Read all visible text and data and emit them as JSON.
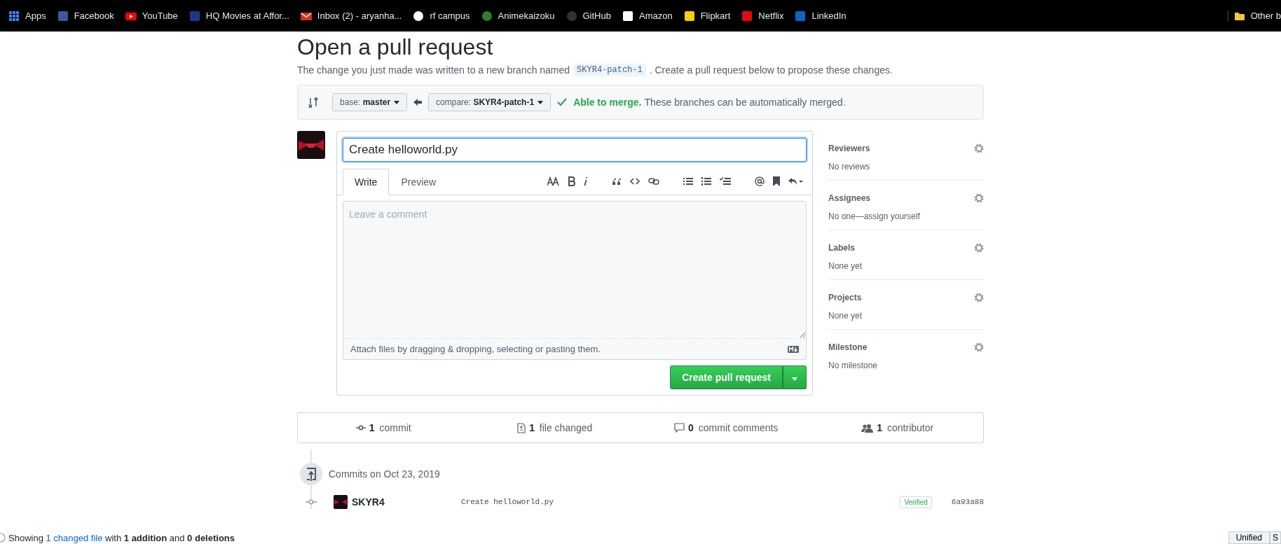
{
  "bookmarks": [
    {
      "label": "Apps",
      "kind": "grid",
      "color": "#4285f4"
    },
    {
      "label": "Facebook",
      "kind": "square",
      "color": "#3b5998"
    },
    {
      "label": "YouTube",
      "kind": "play",
      "color": "#ff0000"
    },
    {
      "label": "HQ Movies at Affor...",
      "kind": "square",
      "color": "#1a3a8a"
    },
    {
      "label": "Inbox (2) - aryanha...",
      "kind": "mail",
      "color": "#d93025"
    },
    {
      "label": "rf campus",
      "kind": "circle",
      "color": "#ffffff"
    },
    {
      "label": "Animekaizoku",
      "kind": "circle",
      "color": "#2e7d32"
    },
    {
      "label": "GitHub",
      "kind": "circle",
      "color": "#333333"
    },
    {
      "label": "Amazon",
      "kind": "square",
      "color": "#ffffff"
    },
    {
      "label": "Flipkart",
      "kind": "square",
      "color": "#f7d000"
    },
    {
      "label": "Netflix",
      "kind": "square",
      "color": "#e50914"
    },
    {
      "label": "LinkedIn",
      "kind": "square",
      "color": "#0a66c2"
    },
    {
      "label": "Other b",
      "kind": "folder",
      "color": "#f4c542"
    }
  ],
  "title": "Open a pull request",
  "intro": {
    "before": "The change you just made was written to a new branch named",
    "branch": "SKYR4-patch-1",
    "after": ". Create a pull request below to propose these changes."
  },
  "compare": {
    "base_label": "base:",
    "base": "master",
    "compare_label": "compare:",
    "compare": "SKYR4-patch-1",
    "status": "Able to merge.",
    "note": "These branches can be automatically merged."
  },
  "form": {
    "title_value": "Create helloworld.py",
    "tabs": [
      {
        "label": "Write",
        "selected": true
      },
      {
        "label": "Preview",
        "selected": false
      }
    ],
    "placeholder": "Leave a comment",
    "attach": "Attach files by dragging & dropping, selecting or pasting them.",
    "submit": "Create pull request"
  },
  "sidebar": [
    {
      "heading": "Reviewers",
      "value": "No reviews"
    },
    {
      "heading": "Assignees",
      "value": "No one—assign yourself"
    },
    {
      "heading": "Labels",
      "value": "None yet"
    },
    {
      "heading": "Projects",
      "value": "None yet"
    },
    {
      "heading": "Milestone",
      "value": "No milestone"
    }
  ],
  "stats": [
    {
      "kind": "commit",
      "count": "1",
      "label": "commit"
    },
    {
      "kind": "file",
      "count": "1",
      "label": "file changed"
    },
    {
      "kind": "comment",
      "count": "0",
      "label": "commit comments"
    },
    {
      "kind": "people",
      "count": "1",
      "label": "contributor"
    }
  ],
  "commits_heading": "Commits on Oct 23, 2019",
  "commits": [
    {
      "author": "SKYR4",
      "message": "Create helloworld.py",
      "badge": "Verified",
      "sha": "6a93a88"
    }
  ],
  "summary": {
    "before": "Showing",
    "link": "1 changed file",
    "after": "with **1 addition** and **0 deletions**"
  },
  "view_buttons": [
    {
      "label": "Unified",
      "selected": false
    },
    {
      "label": "S",
      "selected": false
    }
  ]
}
